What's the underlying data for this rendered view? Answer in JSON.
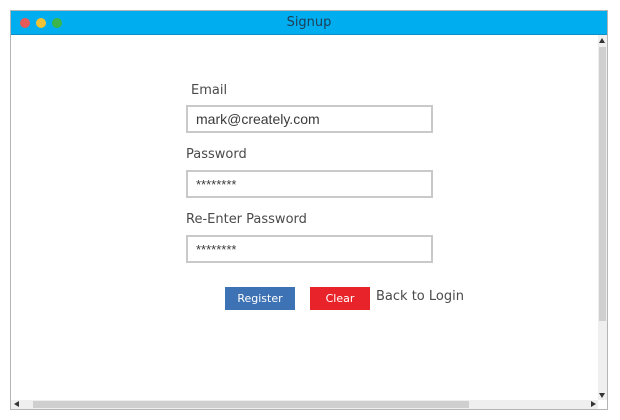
{
  "window": {
    "title": "Signup",
    "colors": {
      "titlebar": "#00aeef",
      "close": "#e85a5a",
      "minimize": "#f0c234",
      "maximize": "#3cb54a"
    }
  },
  "form": {
    "email": {
      "label": "Email",
      "value": "mark@creately.com"
    },
    "password": {
      "label": "Password",
      "value": "********"
    },
    "reenter_password": {
      "label": "Re-Enter Password",
      "value": "********"
    }
  },
  "actions": {
    "register_label": "Register",
    "register_color": "#3d72b4",
    "clear_label": "Clear",
    "clear_color": "#e8242a",
    "back_link_label": "Back to Login"
  }
}
